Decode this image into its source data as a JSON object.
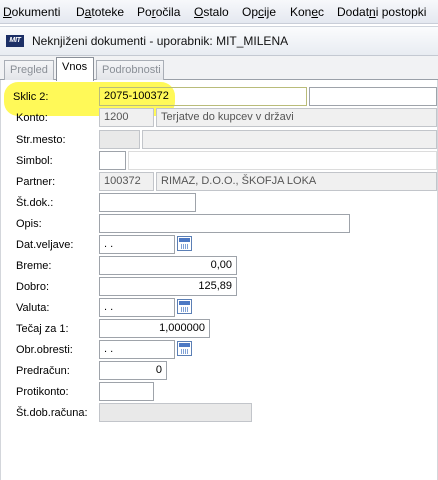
{
  "menu": {
    "items": [
      {
        "label": "Dokumenti",
        "underline": "D"
      },
      {
        "label": "Datoteke",
        "underline": "a"
      },
      {
        "label": "Poročila",
        "underline": "r"
      },
      {
        "label": "Ostalo",
        "underline": "O"
      },
      {
        "label": "Opcije",
        "underline": "c"
      },
      {
        "label": "Konec",
        "underline": "e"
      },
      {
        "label": "Dodatni postopki",
        "underline": "n"
      }
    ]
  },
  "window": {
    "logo_text": "MIT",
    "title": "Neknjiženi dokumenti - uporabnik: MIT_MILENA"
  },
  "tabs": [
    {
      "label": "Pregled",
      "active": false
    },
    {
      "label": "Vnos",
      "active": true
    },
    {
      "label": "Podrobnosti",
      "active": false
    }
  ],
  "form": {
    "sklic": {
      "label": "Sklic 2:",
      "value": "2075-100372"
    },
    "konto": {
      "label": "Konto:",
      "code": "1200",
      "description": "Terjatve do kupcev v državi"
    },
    "str_mesto": {
      "label": "Str.mesto:",
      "code": "",
      "description": ""
    },
    "simbol": {
      "label": "Simbol:",
      "value": "",
      "description": ""
    },
    "partner": {
      "label": "Partner:",
      "code": "100372",
      "description": "RIMAZ,  D.O.O., ŠKOFJA LOKA"
    },
    "st_dok": {
      "label": "Št.dok.:",
      "value": ""
    },
    "opis": {
      "label": "Opis:",
      "value": ""
    },
    "dat_veljave": {
      "label": "Dat.veljave:",
      "value": " .  ."
    },
    "breme": {
      "label": "Breme:",
      "value": "0,00"
    },
    "dobro": {
      "label": "Dobro:",
      "value": "125,89"
    },
    "valuta": {
      "label": "Valuta:",
      "value": " .  ."
    },
    "tecaj": {
      "label": "Tečaj za 1:",
      "value": "1,000000"
    },
    "obr_obresti": {
      "label": "Obr.obresti:",
      "value": " .  ."
    },
    "predracun": {
      "label": "Predračun:",
      "value": "0"
    },
    "protikonto": {
      "label": "Protikonto:",
      "value": ""
    },
    "st_dob_racuna": {
      "label": "Št.dob.računa:",
      "value": ""
    }
  },
  "colors": {
    "highlight": "#fff94a",
    "logo_bg": "#1c2f66"
  }
}
